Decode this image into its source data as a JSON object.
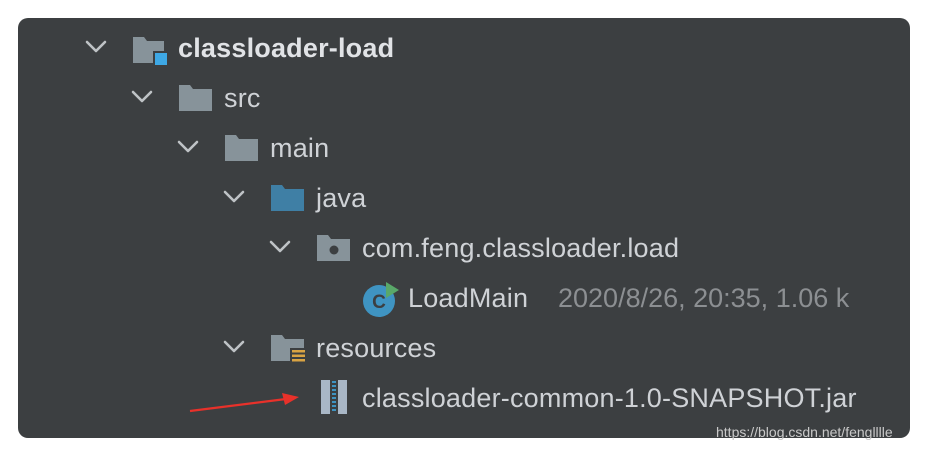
{
  "tree": {
    "items": [
      {
        "label": "classloader-load",
        "icon": "module-folder-icon"
      },
      {
        "label": "src",
        "icon": "folder-icon"
      },
      {
        "label": "main",
        "icon": "folder-icon"
      },
      {
        "label": "java",
        "icon": "source-root-folder-icon"
      },
      {
        "label": "com.feng.classloader.load",
        "icon": "package-icon"
      },
      {
        "label": "LoadMain",
        "meta": "2020/8/26, 20:35, 1.06 k",
        "icon": "java-class-run-icon"
      },
      {
        "label": "resources",
        "icon": "resources-folder-icon"
      },
      {
        "label": "classloader-common-1.0-SNAPSHOT.jar",
        "icon": "jar-archive-icon"
      }
    ]
  },
  "annotation": {
    "arrow_color": "#e8312a"
  },
  "watermark": "https://blog.csdn.net/fenglllle",
  "colors": {
    "panel_bg": "#3c3f41",
    "folder": "#87939a",
    "source_root": "#3f7fa5",
    "module_badge": "#3ea8e5",
    "class_icon": "#3f94c2",
    "run_badge": "#59a869",
    "resources_badge": "#d9a343"
  }
}
